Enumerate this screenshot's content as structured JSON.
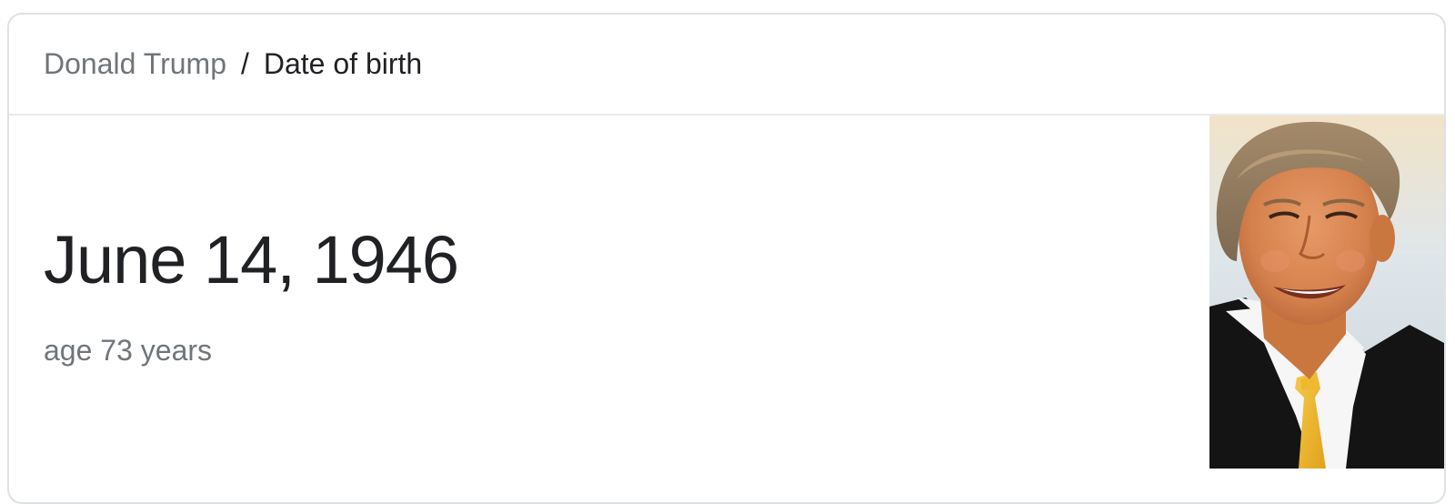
{
  "breadcrumb": {
    "parent": "Donald Trump",
    "separator": "/",
    "current": "Date of birth"
  },
  "answer": {
    "value": "June 14, 1946",
    "subtitle": "age 73 years"
  },
  "colors": {
    "primary_text": "#202124",
    "secondary_text": "#70757a",
    "border": "#dfe1e5"
  }
}
